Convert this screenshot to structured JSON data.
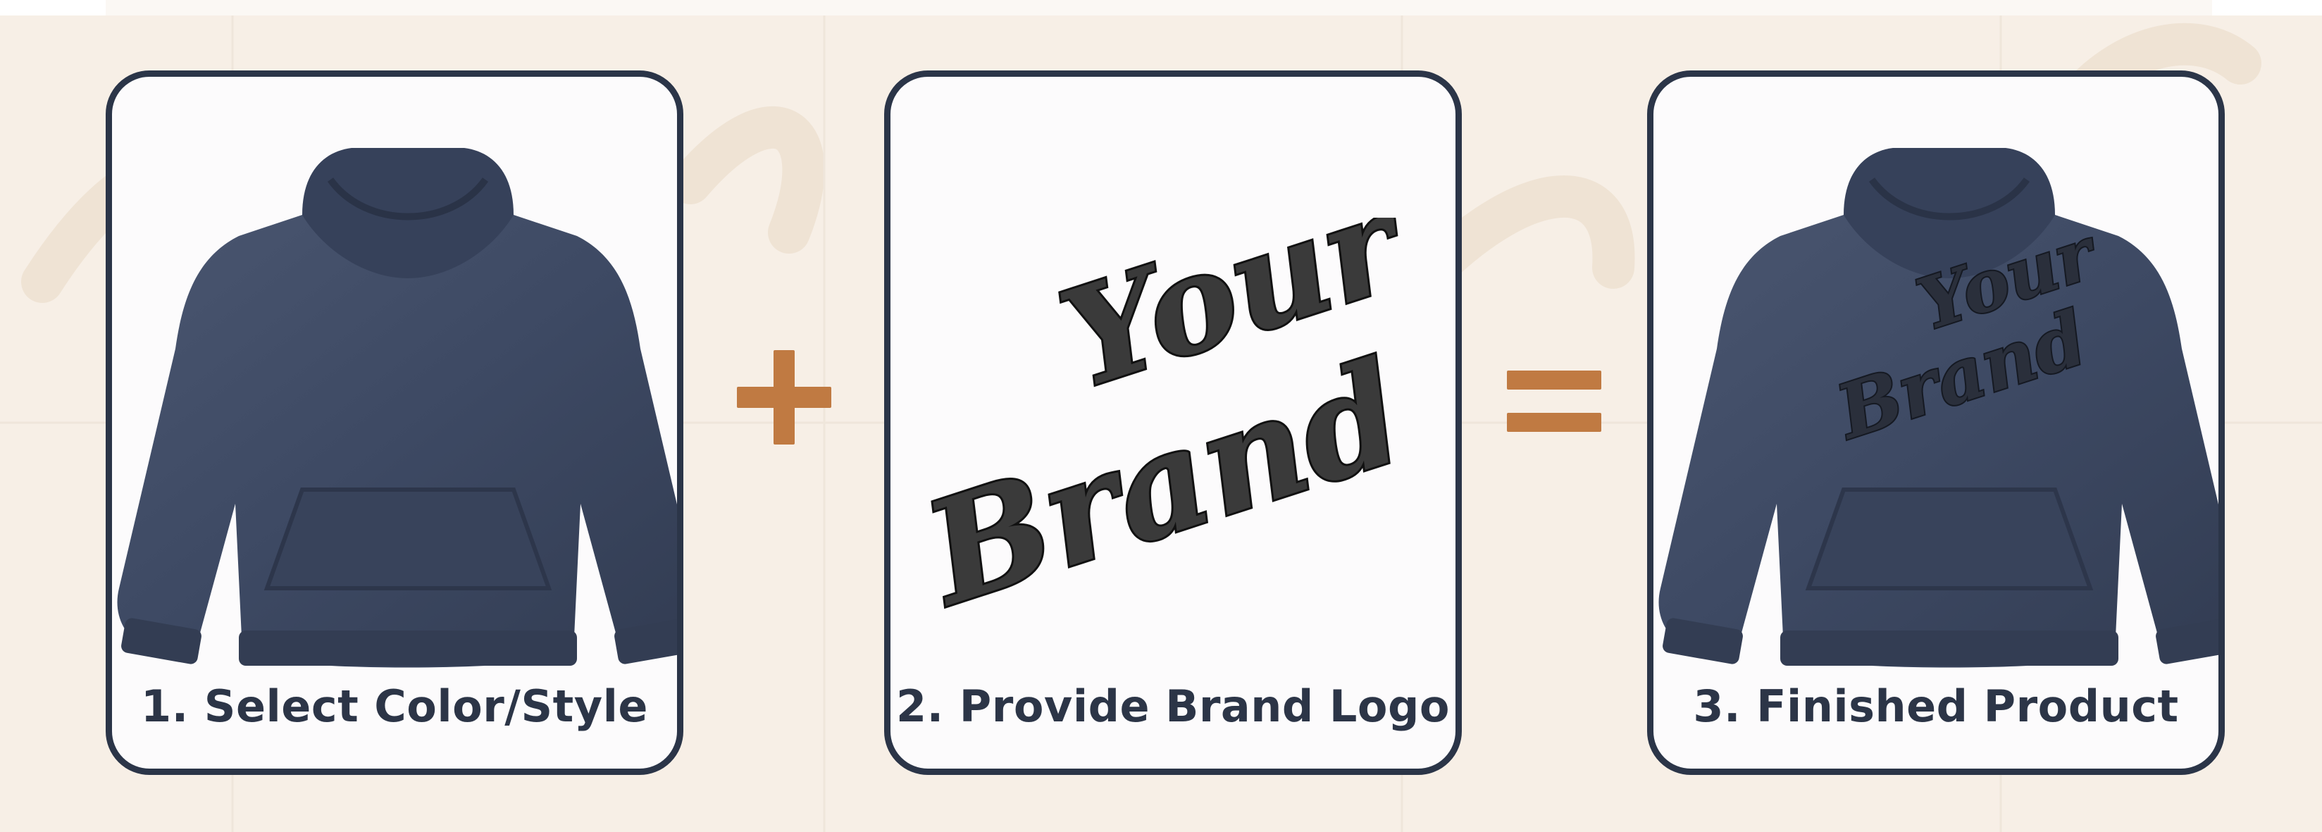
{
  "steps": [
    {
      "caption": "1. Select Color/Style",
      "image": "blank-hoodie"
    },
    {
      "caption": "2. Provide Brand Logo",
      "image": "brand-logo",
      "logo_text": [
        "Your",
        "Brand"
      ]
    },
    {
      "caption": "3. Finished Product",
      "image": "branded-hoodie",
      "logo_text": [
        "Your",
        "Brand"
      ]
    }
  ],
  "operators": {
    "plus": "plus-icon",
    "equals": "equals-icon"
  },
  "colors": {
    "background": "#f7efe6",
    "card_border": "#2b3548",
    "caption_text": "#2c3547",
    "operator": "#c07a42",
    "hoodie": "#3d4963"
  }
}
